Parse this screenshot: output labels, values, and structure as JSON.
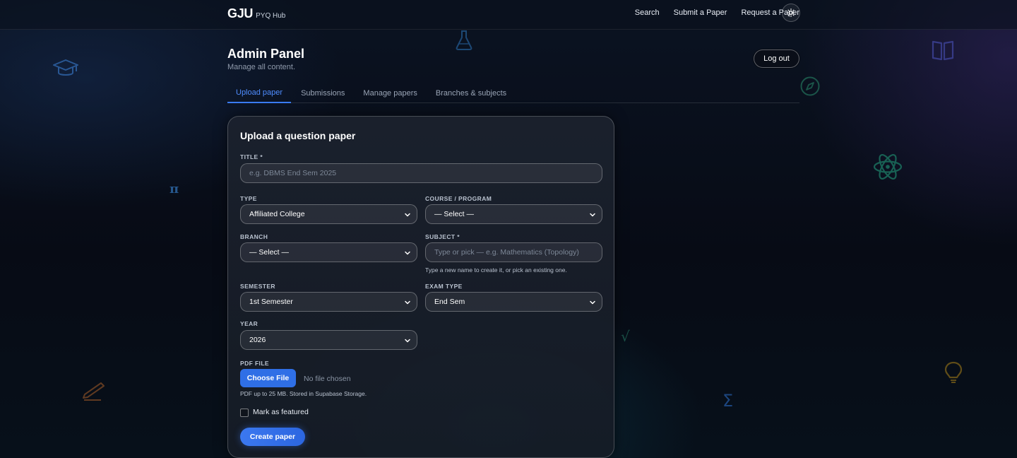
{
  "navbar": {
    "brand_main": "GJU",
    "brand_sub": "PYQ Hub",
    "links": [
      "Search",
      "Submit a Paper",
      "Request a Paper"
    ],
    "theme_icon": "sun-icon"
  },
  "header": {
    "title": "Admin Panel",
    "subtitle": "Manage all content.",
    "logout_label": "Log out"
  },
  "tabs": [
    {
      "label": "Upload paper",
      "active": true
    },
    {
      "label": "Submissions",
      "active": false
    },
    {
      "label": "Manage papers",
      "active": false
    },
    {
      "label": "Branches & subjects",
      "active": false
    }
  ],
  "form": {
    "title": "Upload a question paper",
    "title_label": "TITLE *",
    "title_placeholder": "e.g. DBMS End Sem 2025",
    "type_label": "TYPE",
    "type_value": "Affiliated College",
    "course_label": "COURSE / PROGRAM",
    "course_value": "— Select —",
    "branch_label": "BRANCH",
    "branch_value": "— Select —",
    "subject_label": "SUBJECT *",
    "subject_placeholder": "Type or pick — e.g. Mathematics (Topology)",
    "subject_hint": "Type a new name to create it, or pick an existing one.",
    "semester_label": "SEMESTER",
    "semester_value": "1st Semester",
    "exam_type_label": "EXAM TYPE",
    "exam_type_value": "End Sem",
    "year_label": "YEAR",
    "year_value": "2026",
    "pdf_label": "PDF FILE",
    "choose_file_label": "Choose File",
    "no_file_text": "No file chosen",
    "pdf_hint": "PDF up to 25 MB. Stored in Supabase Storage.",
    "featured_label": "Mark as featured",
    "featured_checked": false,
    "create_label": "Create paper"
  },
  "decor": {
    "pi_glyph": "π",
    "sqrt_glyph": "√",
    "sigma_glyph": "Σ",
    "icons": [
      "graduation-cap-icon",
      "flask-icon",
      "book-icon",
      "compass-icon",
      "atom-icon",
      "pencil-icon",
      "lightbulb-icon"
    ]
  },
  "colors": {
    "accent": "#3b7cf6",
    "background": "#080d18",
    "card": "#1c2230"
  }
}
